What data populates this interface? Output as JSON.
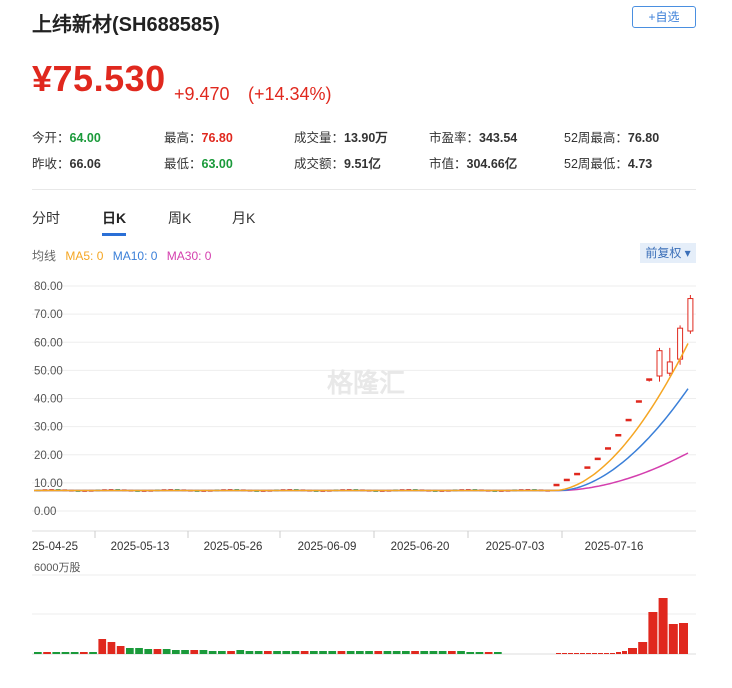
{
  "header": {
    "title": "上纬新材(SH688585)",
    "add_button": "+自选"
  },
  "quote": {
    "price": "¥75.530",
    "change": "+9.470",
    "change_pct": "(+14.34%)",
    "up_color": "#e0281e",
    "down_color": "#1a9a3a"
  },
  "stats": [
    {
      "label": "今开：",
      "value": "64.00",
      "tone": "green"
    },
    {
      "label": "最高：",
      "value": "76.80",
      "tone": "red"
    },
    {
      "label": "成交量：",
      "value": "13.90万",
      "tone": "dark"
    },
    {
      "label": "市盈率：",
      "value": "343.54",
      "tone": "dark"
    },
    {
      "label": "52周最高：",
      "value": "76.80",
      "tone": "dark"
    },
    {
      "label": "昨收：",
      "value": "66.06",
      "tone": "dark"
    },
    {
      "label": "最低：",
      "value": "63.00",
      "tone": "green"
    },
    {
      "label": "成交额：",
      "value": "9.51亿",
      "tone": "dark"
    },
    {
      "label": "市值：",
      "value": "304.66亿",
      "tone": "dark"
    },
    {
      "label": "52周最低：",
      "value": "4.73",
      "tone": "dark"
    }
  ],
  "tabs": [
    "分时",
    "日K",
    "周K",
    "月K"
  ],
  "active_tab": "日K",
  "ma_legend": {
    "label": "均线",
    "items": [
      {
        "name": "MA5: 0",
        "color": "#f5a623"
      },
      {
        "name": "MA10: 0",
        "color": "#3a7fd8"
      },
      {
        "name": "MA30: 0",
        "color": "#d43fae"
      }
    ]
  },
  "adjust": "前复权",
  "watermark": "格隆汇",
  "volume_unit": "6000万股",
  "chart_data": {
    "type": "candlestick",
    "y_ticks": [
      "80.00",
      "70.00",
      "60.00",
      "50.00",
      "40.00",
      "30.00",
      "20.00",
      "10.00",
      "0.00"
    ],
    "ylim": [
      0,
      80
    ],
    "x_ticks": [
      "25-04-25",
      "2025-05-13",
      "2025-05-26",
      "2025-06-09",
      "2025-06-20",
      "2025-07-03",
      "2025-07-16"
    ],
    "candles_tail": [
      {
        "o": 9.0,
        "c": 9.5,
        "h": 9.6,
        "l": 9.0
      },
      {
        "o": 11.0,
        "c": 11.3,
        "h": 11.4,
        "l": 11.0
      },
      {
        "o": 13.2,
        "c": 13.4,
        "h": 13.5,
        "l": 13.2
      },
      {
        "o": 15.5,
        "c": 15.7,
        "h": 15.8,
        "l": 15.5
      },
      {
        "o": 18.6,
        "c": 18.8,
        "h": 18.9,
        "l": 18.6
      },
      {
        "o": 22.3,
        "c": 22.5,
        "h": 22.6,
        "l": 22.3
      },
      {
        "o": 27.0,
        "c": 27.2,
        "h": 27.3,
        "l": 27.0
      },
      {
        "o": 32.4,
        "c": 32.6,
        "h": 32.7,
        "l": 32.4
      },
      {
        "o": 39.0,
        "c": 39.2,
        "h": 39.3,
        "l": 39.0
      },
      {
        "o": 46.8,
        "c": 47.0,
        "h": 47.1,
        "l": 46.0
      },
      {
        "o": 48.0,
        "c": 57.0,
        "h": 58.0,
        "l": 46.0
      },
      {
        "o": 49.0,
        "c": 53.0,
        "h": 58.0,
        "l": 48.0
      },
      {
        "o": 54.0,
        "c": 65.0,
        "h": 66.0,
        "l": 52.0
      },
      {
        "o": 64.0,
        "c": 75.53,
        "h": 76.8,
        "l": 63.0
      }
    ],
    "ma5_end": 61.0,
    "ma10_end": 44.5,
    "ma30_end": 21.0,
    "volume_note": "bars relative to unit"
  }
}
